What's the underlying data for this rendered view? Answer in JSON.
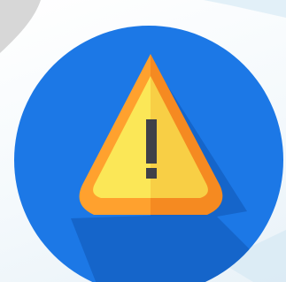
{
  "scene": {
    "subject": "warning-icon",
    "colors": {
      "background": "#f7fbfd",
      "corner_shape": "#d7d7d7",
      "circle": "#1c78e6",
      "circle_shadow": "#1461c4",
      "triangle_border_light": "#ffa12e",
      "triangle_border_dark": "#f58a21",
      "triangle_fill_light": "#fbe757",
      "triangle_fill_dark": "#f8cf45",
      "exclamation": "#3f4048"
    }
  }
}
